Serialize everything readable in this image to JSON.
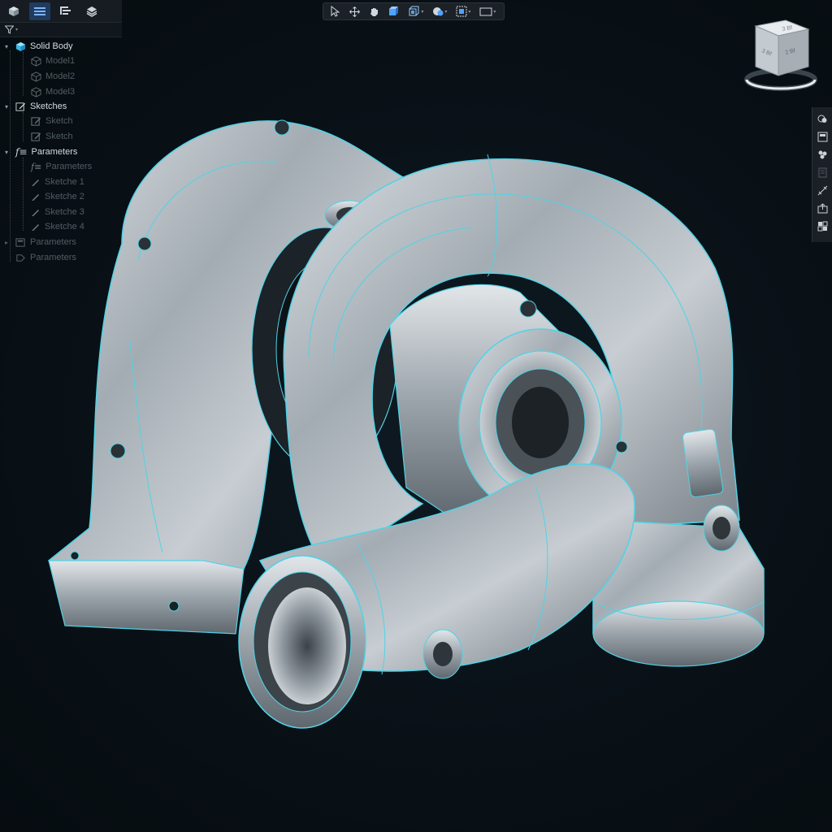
{
  "panel": {
    "tabs": [
      {
        "icon": "solid-body-icon",
        "active": false
      },
      {
        "icon": "list-icon",
        "active": true
      },
      {
        "icon": "tree-structure-icon",
        "active": false
      },
      {
        "icon": "layers-icon",
        "active": false
      }
    ],
    "filter_icon": "filter-icon"
  },
  "tree": {
    "solid_body": {
      "label": "Solid Body",
      "children": [
        "Model1",
        "Model2",
        "Model3"
      ]
    },
    "sketches": {
      "label": "Sketches",
      "children": [
        "Sketch",
        "Sketch"
      ]
    },
    "parameters": {
      "label": "Parameters",
      "children": [
        "Parameters",
        "Sketche 1",
        "Sketche 2",
        "Sketche 3",
        "Sketche 4"
      ]
    },
    "extra": [
      "Parameters",
      "Parameters"
    ]
  },
  "toolbar": {
    "buttons": [
      "select-icon",
      "move-icon",
      "pan-icon",
      "view-front-icon",
      "view-iso-icon",
      "render-mode-icon",
      "section-icon",
      "display-mode-icon"
    ]
  },
  "viewcube": {
    "faces": [
      "3 Bf",
      "2 Bf"
    ],
    "left_face": "3 Bf"
  },
  "right_tools": [
    "appearance-icon",
    "inspect-icon",
    "components-icon",
    "measure-icon",
    "dimension-icon",
    "export-icon",
    "grid-icon"
  ],
  "colors": {
    "background": "#091117",
    "panel": "#161c22",
    "accent": "#1f6fbf",
    "edge_highlight": "#4fd3e6",
    "metal": "#aab3ba"
  }
}
